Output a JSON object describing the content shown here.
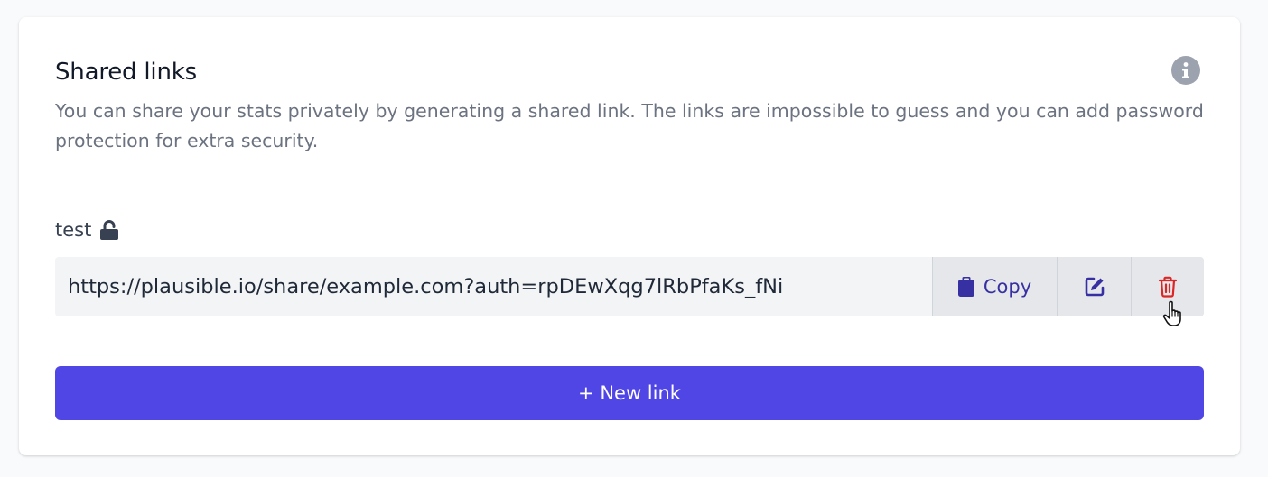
{
  "section": {
    "title": "Shared links",
    "description": "You can share your stats privately by generating a shared link. The links are impossible to guess and you can add password protection for extra security.",
    "info_icon": "info-circle-icon"
  },
  "links": [
    {
      "name": "test",
      "lock_icon": "unlocked-lock-icon",
      "url": "https://plausible.io/share/example.com?auth=rpDEwXqg7lRbPfaKs_fNi",
      "copy_label": "Copy",
      "copy_icon": "clipboard-icon",
      "edit_icon": "edit-icon",
      "delete_icon": "trash-icon"
    }
  ],
  "new_link_label": "+ New link",
  "colors": {
    "accent": "#4f46e5",
    "copy_text": "#3730a3",
    "delete": "#dc2626",
    "muted": "#6b7280"
  }
}
